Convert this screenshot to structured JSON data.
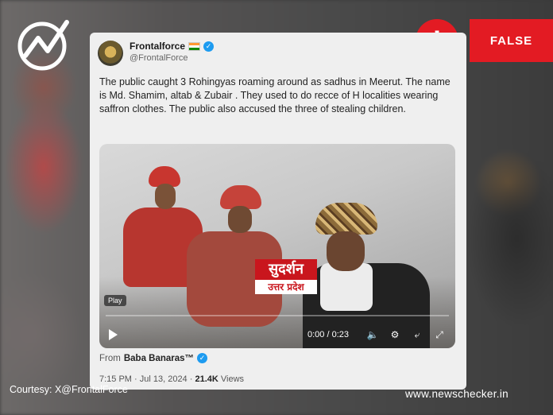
{
  "verdict": {
    "label": "FALSE",
    "color": "#e31b23",
    "icon": "exclamation-icon"
  },
  "brand_logo": {
    "icon": "newschecker-logo"
  },
  "tweet": {
    "display_name": "Frontalforce",
    "handle": "@FrontalForce",
    "text": "The public caught 3 Rohingyas roaming around as sadhus in Meerut. The name is Md. Shamim, altab & Zubair . They used to do recce of H localities wearing saffron clothes. The public also accused the three of stealing children.",
    "media": {
      "play_label": "Play",
      "channel_line1": "सुदर्शन",
      "channel_line2": "उत्तर प्रदेश",
      "time": "0:00 / 0:23",
      "progress": 0.0
    },
    "from_prefix": "From",
    "from_account": "Baba Banaras™",
    "timestamp": "7:15 PM · Jul 13, 2024 ·",
    "views_count": "21.4K",
    "views_label": "Views"
  },
  "courtesy": "Courtesy: X@FrontalForce",
  "site": "www.newschecker.in"
}
